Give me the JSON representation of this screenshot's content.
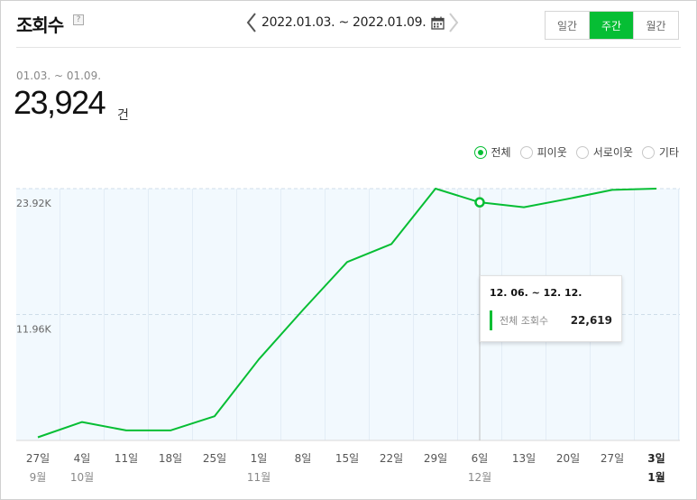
{
  "header": {
    "title": "조회수",
    "help": "?",
    "date_range": "2022.01.03. ~ 2022.01.09.",
    "period_tabs": [
      {
        "label": "일간",
        "active": false
      },
      {
        "label": "주간",
        "active": true
      },
      {
        "label": "월간",
        "active": false
      }
    ]
  },
  "summary": {
    "range": "01.03. ~ 01.09.",
    "value": "23,924",
    "unit": "건"
  },
  "legend": [
    {
      "label": "전체",
      "selected": true
    },
    {
      "label": "피이웃",
      "selected": false
    },
    {
      "label": "서로이웃",
      "selected": false
    },
    {
      "label": "기타",
      "selected": false
    }
  ],
  "colors": {
    "accent": "#06be34",
    "plot_bg": "#f2f9fe"
  },
  "tooltip": {
    "title": "12. 06. ~ 12. 12.",
    "label": "전체 조회수",
    "value": "22,619"
  },
  "chart_data": {
    "type": "line",
    "categories": [
      "27일",
      "4일",
      "11일",
      "18일",
      "25일",
      "1일",
      "8일",
      "15일",
      "22일",
      "29일",
      "6일",
      "13일",
      "20일",
      "27일",
      "3일"
    ],
    "month_labels": [
      "9월",
      "10월",
      "",
      "",
      "",
      "11월",
      "",
      "",
      "",
      "",
      "12월",
      "",
      "",
      "",
      "1월"
    ],
    "series": [
      {
        "name": "전체",
        "values": [
          300,
          1750,
          950,
          950,
          2300,
          7700,
          12400,
          16950,
          18650,
          23920,
          22619,
          22150,
          22950,
          23800,
          23924
        ]
      }
    ],
    "ylim": [
      0,
      23920
    ],
    "yticks": [
      {
        "value": 11960,
        "label": "11.96K"
      },
      {
        "value": 23920,
        "label": "23.92K"
      }
    ],
    "highlight_index": 10,
    "grid": true
  }
}
